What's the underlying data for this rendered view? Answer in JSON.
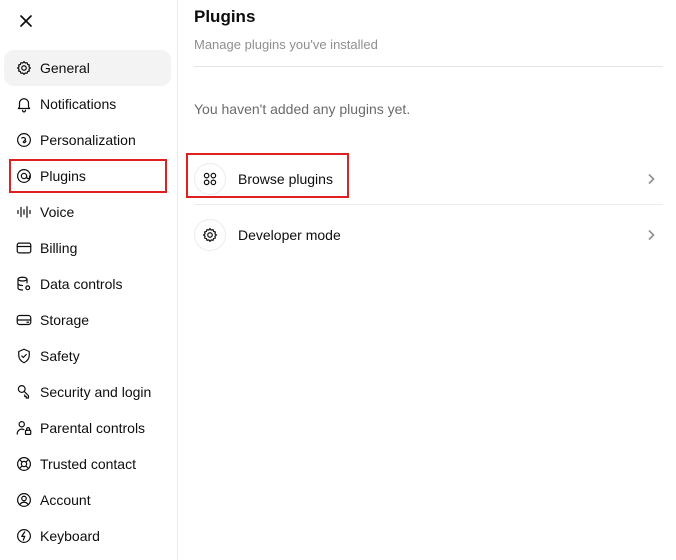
{
  "sidebar": {
    "close_icon": "close-icon",
    "items": [
      {
        "label": "General",
        "icon": "gear-icon"
      },
      {
        "label": "Notifications",
        "icon": "bell-icon"
      },
      {
        "label": "Personalization",
        "icon": "personalization-icon"
      },
      {
        "label": "Plugins",
        "icon": "plugins-icon"
      },
      {
        "label": "Voice",
        "icon": "voice-icon"
      },
      {
        "label": "Billing",
        "icon": "card-icon"
      },
      {
        "label": "Data controls",
        "icon": "database-icon"
      },
      {
        "label": "Storage",
        "icon": "storage-icon"
      },
      {
        "label": "Safety",
        "icon": "shield-icon"
      },
      {
        "label": "Security and login",
        "icon": "key-icon"
      },
      {
        "label": "Parental controls",
        "icon": "user-lock-icon"
      },
      {
        "label": "Trusted contact",
        "icon": "lifebuoy-icon"
      },
      {
        "label": "Account",
        "icon": "account-icon"
      },
      {
        "label": "Keyboard",
        "icon": "keyboard-icon"
      }
    ],
    "active": "General",
    "highlighted": "Plugins"
  },
  "main": {
    "title": "Plugins",
    "subtitle": "Manage plugins you've installed",
    "empty_text": "You haven't added any plugins yet.",
    "rows": [
      {
        "label": "Browse plugins",
        "icon": "grid-icon"
      },
      {
        "label": "Developer mode",
        "icon": "gear-icon"
      }
    ]
  },
  "colors": {
    "highlight": "#e02020",
    "active_bg": "#f3f3f3",
    "muted_text": "#8f8f8f"
  }
}
